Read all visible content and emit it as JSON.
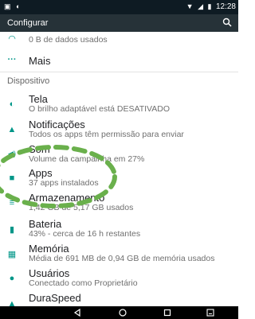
{
  "status_bar": {
    "left_icons": "▣ ◐",
    "right_icons": [
      "wifi-icon",
      "signal-icon",
      "battery-icon"
    ],
    "time": "12:28"
  },
  "app_bar": {
    "title": "Configurar",
    "search_icon": "search-icon"
  },
  "top_items": [
    {
      "title": "",
      "subtitle": "0 B de dados usados",
      "icon": "data-usage-icon"
    },
    {
      "title": "Mais",
      "subtitle": "",
      "icon": "more-icon",
      "icon_glyph": "···"
    }
  ],
  "section": {
    "header": "Dispositivo",
    "items": [
      {
        "title": "Tela",
        "subtitle": "O brilho adaptável está DESATIVADO",
        "icon": "brightness-icon",
        "glyph": "◐"
      },
      {
        "title": "Notificações",
        "subtitle": "Todos os apps têm permissão para enviar",
        "icon": "bell-icon",
        "glyph": "▲"
      },
      {
        "title": "Som",
        "subtitle": "Volume da campainha em 27%",
        "icon": "volume-icon",
        "glyph": "◀)"
      },
      {
        "title": "Apps",
        "subtitle": "37 apps instalados",
        "icon": "android-icon",
        "glyph": "■"
      },
      {
        "title": "Armazenamento",
        "subtitle": "1,42 GB de 5,17 GB usados",
        "icon": "storage-icon",
        "glyph": "≡"
      },
      {
        "title": "Bateria",
        "subtitle": "43% - cerca de 16 h restantes",
        "icon": "battery-icon",
        "glyph": "▮"
      },
      {
        "title": "Memória",
        "subtitle": "Média de 691 MB de 0,94 GB de memória usados",
        "icon": "memory-icon",
        "glyph": "▦"
      },
      {
        "title": "Usuários",
        "subtitle": "Conectado como Proprietário",
        "icon": "person-icon",
        "glyph": "●"
      },
      {
        "title": "DuraSpeed",
        "subtitle": "",
        "icon": "speed-icon",
        "glyph": "▲"
      }
    ]
  },
  "nav_bar": {
    "buttons": [
      "back-icon",
      "home-icon",
      "recents-icon",
      "screenshot-icon"
    ]
  },
  "annotation": {
    "color": "#6ab04c"
  }
}
